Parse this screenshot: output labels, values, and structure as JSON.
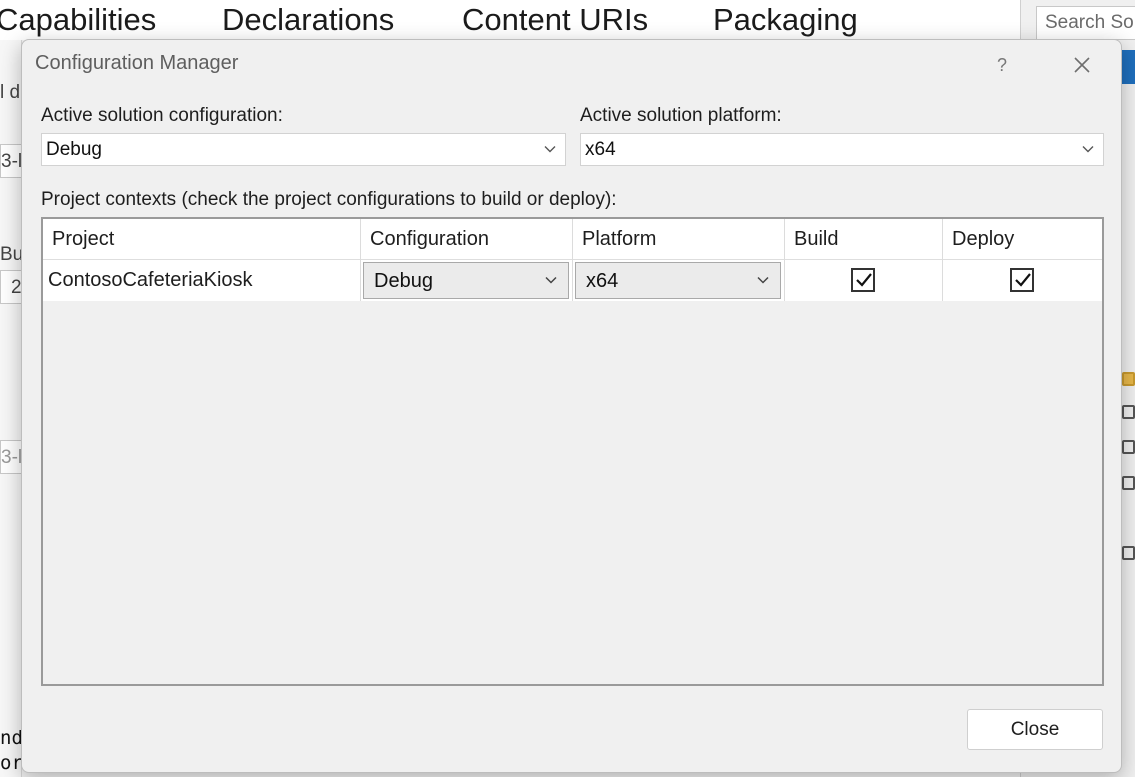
{
  "background": {
    "tabs": [
      "Capabilities",
      "Declarations",
      "Content URIs",
      "Packaging"
    ],
    "search_placeholder": "Search So",
    "left_fragments": [
      "l d",
      "3-l",
      "Bu",
      "2",
      "3-l"
    ],
    "bottom_fragments": [
      "nd",
      "or"
    ]
  },
  "dialog": {
    "title": "Configuration Manager",
    "help_label": "?",
    "active_config_label": "Active solution configuration:",
    "active_config_value": "Debug",
    "active_platform_label": "Active solution platform:",
    "active_platform_value": "x64",
    "contexts_label": "Project contexts (check the project configurations to build or deploy):",
    "grid": {
      "columns": [
        "Project",
        "Configuration",
        "Platform",
        "Build",
        "Deploy"
      ],
      "rows": [
        {
          "project": "ContosoCafeteriaKiosk",
          "configuration": "Debug",
          "platform": "x64",
          "build": true,
          "deploy": true
        }
      ]
    },
    "close_label": "Close"
  }
}
